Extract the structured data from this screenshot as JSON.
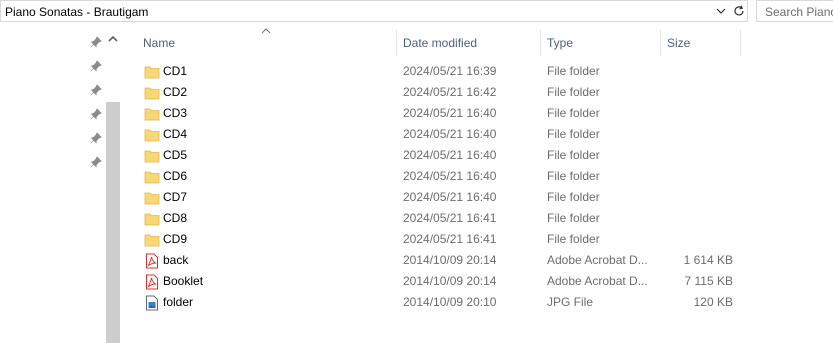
{
  "address_bar": {
    "path": "Piano Sonatas - Brautigam"
  },
  "search": {
    "placeholder": "Search Piano"
  },
  "columns": {
    "name": "Name",
    "date": "Date modified",
    "type": "Type",
    "size": "Size"
  },
  "files": [
    {
      "name": "CD1",
      "date": "2024/05/21 16:39",
      "type": "File folder",
      "size": "",
      "icon": "folder-icon"
    },
    {
      "name": "CD2",
      "date": "2024/05/21 16:42",
      "type": "File folder",
      "size": "",
      "icon": "folder-icon"
    },
    {
      "name": "CD3",
      "date": "2024/05/21 16:40",
      "type": "File folder",
      "size": "",
      "icon": "folder-icon"
    },
    {
      "name": "CD4",
      "date": "2024/05/21 16:40",
      "type": "File folder",
      "size": "",
      "icon": "folder-icon"
    },
    {
      "name": "CD5",
      "date": "2024/05/21 16:40",
      "type": "File folder",
      "size": "",
      "icon": "folder-icon"
    },
    {
      "name": "CD6",
      "date": "2024/05/21 16:40",
      "type": "File folder",
      "size": "",
      "icon": "folder-icon"
    },
    {
      "name": "CD7",
      "date": "2024/05/21 16:40",
      "type": "File folder",
      "size": "",
      "icon": "folder-icon"
    },
    {
      "name": "CD8",
      "date": "2024/05/21 16:41",
      "type": "File folder",
      "size": "",
      "icon": "folder-icon"
    },
    {
      "name": "CD9",
      "date": "2024/05/21 16:41",
      "type": "File folder",
      "size": "",
      "icon": "folder-icon"
    },
    {
      "name": "back",
      "date": "2014/10/09 20:14",
      "type": "Adobe Acrobat D...",
      "size": "1 614 KB",
      "icon": "pdf-icon"
    },
    {
      "name": "Booklet",
      "date": "2014/10/09 20:14",
      "type": "Adobe Acrobat D...",
      "size": "7 115 KB",
      "icon": "pdf-icon"
    },
    {
      "name": "folder",
      "date": "2014/10/09 20:10",
      "type": "JPG File",
      "size": "120 KB",
      "icon": "jpg-icon"
    }
  ],
  "colors": {
    "header_text": "#4c607a",
    "detail_text": "#6d6d6d",
    "folder": "#f8d775",
    "pdf": "#d9302c"
  }
}
